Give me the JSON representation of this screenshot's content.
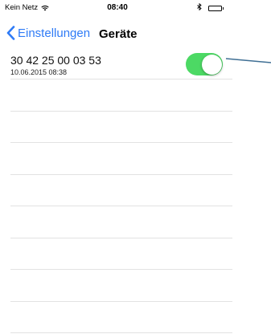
{
  "status_bar": {
    "carrier": "Kein Netz",
    "time": "08:40",
    "icons": {
      "wifi": "wifi-icon",
      "bluetooth": "bluetooth-icon",
      "battery": "battery-icon"
    }
  },
  "nav": {
    "back_label": "Einstellungen",
    "title": "Geräte",
    "back_icon": "chevron-left-icon"
  },
  "devices": [
    {
      "id": "30 42 25 00 03 53",
      "timestamp": "10.06.2015 08:38",
      "enabled": true
    }
  ],
  "colors": {
    "accent": "#2f7bf6",
    "toggle_on": "#4cd964",
    "separator": "#e2e2e2",
    "callout_line": "#3f6f94"
  }
}
